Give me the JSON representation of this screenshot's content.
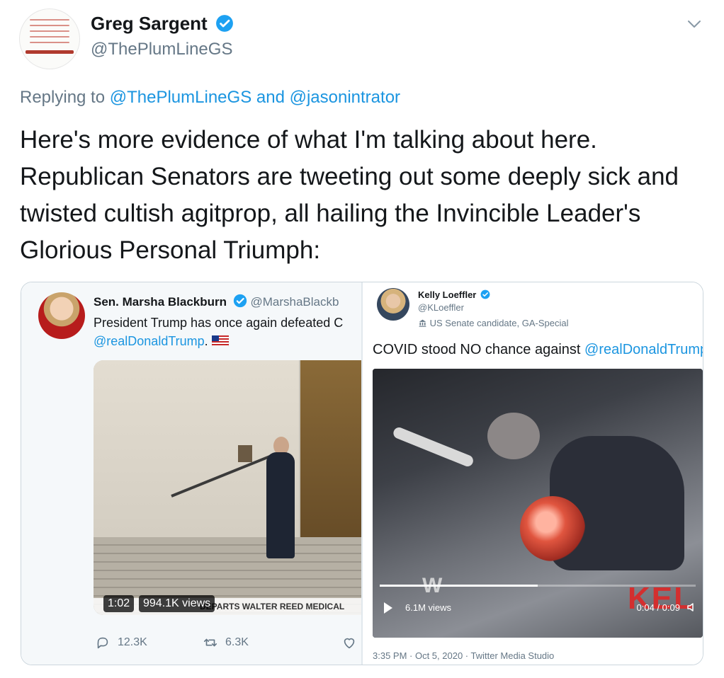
{
  "tweet": {
    "author_name": "Greg Sargent",
    "author_handle": "@ThePlumLineGS",
    "replying_prefix": "Replying to",
    "replying_to_1": "@ThePlumLineGS",
    "replying_and": "and",
    "replying_to_2": "@jasonintrator",
    "text": "Here's more evidence of what I'm talking about here. Republican Senators are tweeting out some deeply sick and twisted cultish agitprop, all hailing the Invincible Leader's Glorious Personal Triumph:"
  },
  "embed_left": {
    "name": "Sen. Marsha Blackburn",
    "handle": "@MarshaBlackb",
    "text_line1": "President Trump has once again defeated C",
    "mention": "@realDonaldTrump",
    "mention_suffix": ".",
    "video_duration": "1:02",
    "video_views": "994.1K views",
    "chyron": "DEPARTS WALTER REED MEDICAL",
    "reply_count": "12.3K",
    "retweet_count": "6.3K"
  },
  "embed_right": {
    "name": "Kelly Loeffler",
    "handle": "@KLoeffler",
    "label": "US Senate candidate, GA-Special",
    "text_prefix": "COVID stood NO chance against ",
    "mention": "@realDonaldTrump",
    "video_views": "6.1M views",
    "video_time": "0:04 / 0:09",
    "progress": 0.5,
    "timestamp": "3:35 PM · Oct 5, 2020 · Twitter Media Studio",
    "overlay_brand": "KEL"
  },
  "colors": {
    "link": "#1b95e0",
    "verified": "#1da1f2",
    "muted": "#657786"
  },
  "icons": [
    "verified-badge-icon",
    "chevron-down-icon",
    "reply-icon",
    "retweet-icon",
    "like-icon",
    "play-icon",
    "volume-icon",
    "government-label-icon",
    "us-flag-icon"
  ]
}
